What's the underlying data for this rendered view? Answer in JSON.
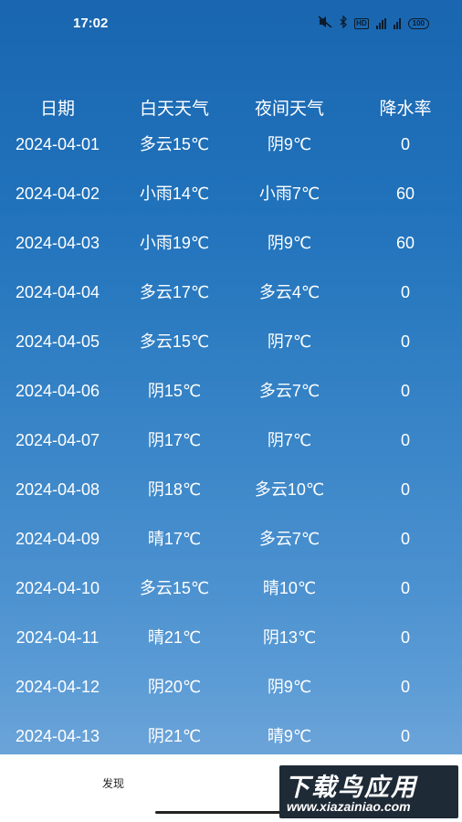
{
  "status_bar": {
    "time": "17:02",
    "icons": [
      "mute-icon",
      "bluetooth-icon",
      "hd-icon",
      "signal-5g-icon",
      "signal-icon",
      "battery-icon"
    ],
    "hd_label": "HD",
    "battery_label": "100"
  },
  "table": {
    "headers": [
      "日期",
      "白天天气",
      "夜间天气",
      "降水率"
    ],
    "rows": [
      [
        "2024-04-01",
        "多云15℃",
        "阴9℃",
        "0"
      ],
      [
        "2024-04-02",
        "小雨14℃",
        "小雨7℃",
        "60"
      ],
      [
        "2024-04-03",
        "小雨19℃",
        "阴9℃",
        "60"
      ],
      [
        "2024-04-04",
        "多云17℃",
        "多云4℃",
        "0"
      ],
      [
        "2024-04-05",
        "多云15℃",
        "阴7℃",
        "0"
      ],
      [
        "2024-04-06",
        "阴15℃",
        "多云7℃",
        "0"
      ],
      [
        "2024-04-07",
        "阴17℃",
        "阴7℃",
        "0"
      ],
      [
        "2024-04-08",
        "阴18℃",
        "多云10℃",
        "0"
      ],
      [
        "2024-04-09",
        "晴17℃",
        "多云7℃",
        "0"
      ],
      [
        "2024-04-10",
        "多云15℃",
        "晴10℃",
        "0"
      ],
      [
        "2024-04-11",
        "晴21℃",
        "阴13℃",
        "0"
      ],
      [
        "2024-04-12",
        "阴20℃",
        "阴9℃",
        "0"
      ],
      [
        "2024-04-13",
        "阴21℃",
        "晴9℃",
        "0"
      ]
    ]
  },
  "bottom_nav": {
    "discover_label": "发现"
  },
  "watermark": {
    "main": "下载鸟应用",
    "url": "www.xiazainiao.com"
  },
  "colors": {
    "background_top": "#1a66b0",
    "background_bottom": "#6aa3d8",
    "text": "#ffffff",
    "nav_bg": "#ffffff"
  }
}
